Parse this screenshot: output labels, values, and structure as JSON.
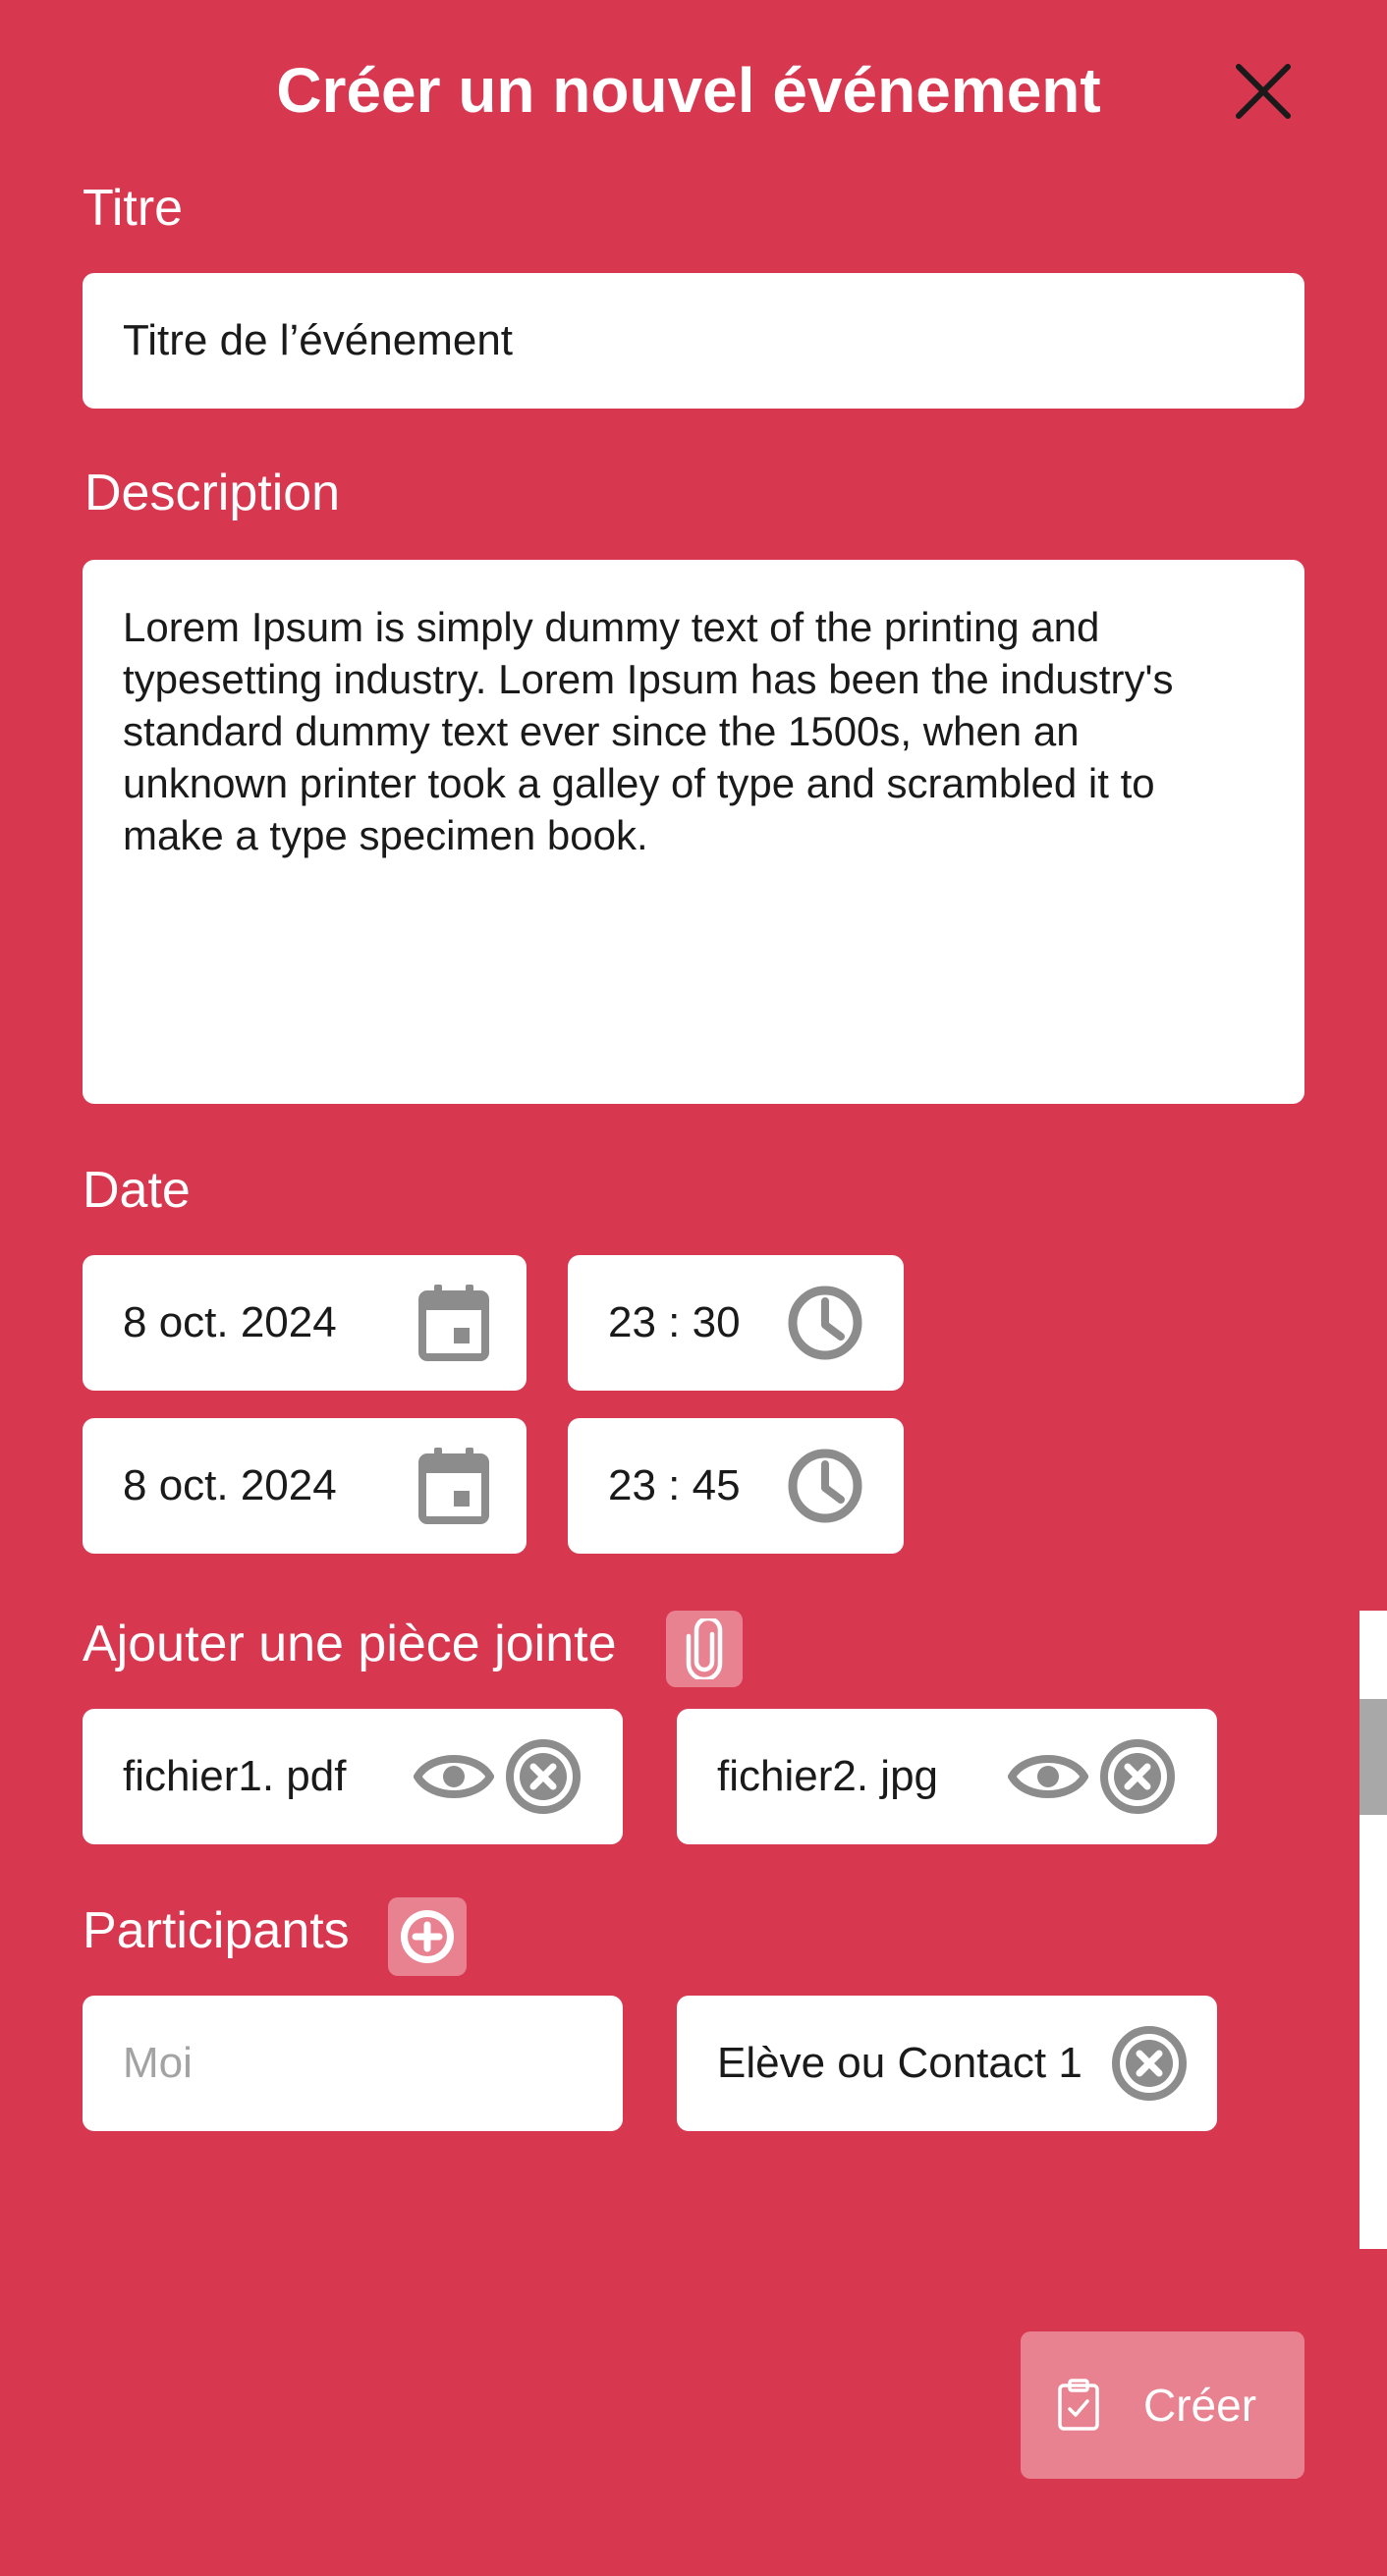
{
  "header": {
    "title": "Créer un nouvel événement",
    "close_icon": "close-icon"
  },
  "titre": {
    "label": "Titre",
    "value": "Titre de l’événement"
  },
  "description": {
    "label": "Description",
    "value": "Lorem Ipsum is simply dummy text of the printing and typesetting industry. Lorem Ipsum has been the industry's standard dummy text ever since the 1500s, when an unknown printer took a galley of  type and scrambled it to make a type specimen book."
  },
  "date": {
    "label": "Date",
    "start": {
      "date": "8 oct. 2024",
      "time": "23 : 30"
    },
    "end": {
      "date": "8 oct. 2024",
      "time": "23 : 45"
    }
  },
  "attachments": {
    "label": "Ajouter une pièce jointe",
    "files": [
      {
        "name": "fichier1. pdf"
      },
      {
        "name": "fichier2. jpg"
      }
    ]
  },
  "participants": {
    "label": "Participants",
    "me_placeholder": "Moi",
    "contact": "Elève ou Contact 1"
  },
  "actions": {
    "create_label": "Créer"
  },
  "colors": {
    "background": "#d83750",
    "button": "#e98290",
    "icon_gray": "#8c8c8c",
    "field_bg": "#ffffff"
  }
}
